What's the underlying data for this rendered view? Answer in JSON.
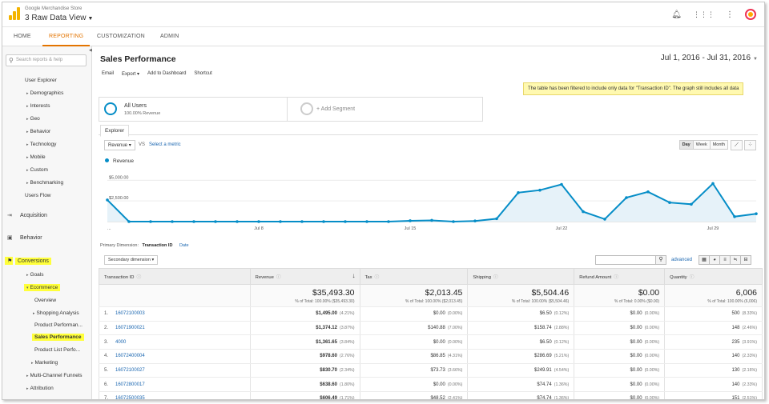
{
  "header": {
    "account_name": "Google Merchandise Store",
    "view_name": "3 Raw Data View",
    "icons": [
      "bell-icon",
      "apps-grid-icon",
      "more-vert-icon",
      "avatar"
    ]
  },
  "nav_tabs": [
    "HOME",
    "REPORTING",
    "CUSTOMIZATION",
    "ADMIN"
  ],
  "sidebar": {
    "search_placeholder": "Search reports & help",
    "items": [
      "User Explorer",
      "Demographics",
      "Interests",
      "Geo",
      "Behavior",
      "Technology",
      "Mobile",
      "Custom",
      "Benchmarking",
      "Users Flow"
    ],
    "sections": [
      "Acquisition",
      "Behavior",
      "Conversions"
    ],
    "conv_items": [
      "Goals",
      "Ecommerce",
      "Overview",
      "Shopping Analysis",
      "Product Performan...",
      "Sales Performance",
      "Product List Perfo...",
      "Marketing",
      "Multi-Channel Funnels",
      "Attribution"
    ]
  },
  "report": {
    "title": "Sales Performance",
    "date_range": "Jul 1, 2016 - Jul 31, 2016",
    "actions": [
      "Email",
      "Export",
      "Add to Dashboard",
      "Shortcut"
    ],
    "filter_note": "The table has been filtered to include only data for \"Transaction ID\". The graph still includes all data",
    "segment": {
      "name": "All Users",
      "sub": "100.00% Revenue",
      "add_label": "+ Add Segment"
    },
    "explorer_tab": "Explorer",
    "metric": "Revenue",
    "vs": "VS",
    "select_metric": "Select a metric",
    "granularity": [
      "Day",
      "Week",
      "Month"
    ],
    "legend": "Revenue",
    "primary_dimension_label": "Primary Dimension:",
    "primary_dimension": "Transaction ID",
    "alt_dimension": "Date",
    "secondary_dimension": "Secondary dimension",
    "advanced": "advanced"
  },
  "chart_data": {
    "type": "area",
    "series": [
      {
        "name": "Revenue",
        "values": [
          2620,
          0,
          0,
          0,
          0,
          0,
          0,
          0,
          0,
          0,
          0,
          0,
          0,
          0,
          100,
          150,
          0,
          80,
          350,
          3500,
          3800,
          4500,
          1200,
          300,
          2900,
          3600,
          2300,
          2100,
          4600,
          600,
          950
        ]
      }
    ],
    "y_ticks": [
      "$5,000.00",
      "$2,500.00"
    ],
    "x_ticks": [
      "Jul 8",
      "Jul 15",
      "Jul 22",
      "Jul 29"
    ],
    "x_start_tick": "...",
    "ylim": [
      0,
      6000
    ],
    "color": "#058dc7"
  },
  "table": {
    "headers": [
      "Transaction ID",
      "Revenue",
      "Tax",
      "Shipping",
      "Refund Amount",
      "Quantity"
    ],
    "totals": [
      {
        "value": "$35,493.30",
        "sub": "% of Total: 100.00% ($35,493.30)"
      },
      {
        "value": "$2,013.45",
        "sub": "% of Total: 100.00% ($2,013.45)"
      },
      {
        "value": "$5,504.46",
        "sub": "% of Total: 100.00% ($5,504.46)"
      },
      {
        "value": "$0.00",
        "sub": "% of Total: 0.00% ($0.00)"
      },
      {
        "value": "6,006",
        "sub": "% of Total: 100.00% (6,006)"
      }
    ],
    "rows": [
      {
        "idx": "1.",
        "id": "16072100003",
        "cells": [
          [
            "$1,495.00",
            "(4.21%)"
          ],
          [
            "$0.00",
            "(0.00%)"
          ],
          [
            "$6.50",
            "(0.12%)"
          ],
          [
            "$0.00",
            "(0.00%)"
          ],
          [
            "500",
            "(8.33%)"
          ]
        ]
      },
      {
        "idx": "2.",
        "id": "16071900021",
        "cells": [
          [
            "$1,374.12",
            "(3.87%)"
          ],
          [
            "$140.88",
            "(7.00%)"
          ],
          [
            "$158.74",
            "(2.88%)"
          ],
          [
            "$0.00",
            "(0.00%)"
          ],
          [
            "148",
            "(2.46%)"
          ]
        ]
      },
      {
        "idx": "3.",
        "id": "4000",
        "cells": [
          [
            "$1,361.65",
            "(3.84%)"
          ],
          [
            "$0.00",
            "(0.00%)"
          ],
          [
            "$6.50",
            "(0.12%)"
          ],
          [
            "$0.00",
            "(0.00%)"
          ],
          [
            "235",
            "(3.91%)"
          ]
        ]
      },
      {
        "idx": "4.",
        "id": "16072400004",
        "cells": [
          [
            "$978.60",
            "(2.76%)"
          ],
          [
            "$86.85",
            "(4.31%)"
          ],
          [
            "$286.69",
            "(5.21%)"
          ],
          [
            "$0.00",
            "(0.00%)"
          ],
          [
            "140",
            "(2.33%)"
          ]
        ]
      },
      {
        "idx": "5.",
        "id": "16072100027",
        "cells": [
          [
            "$830.70",
            "(2.34%)"
          ],
          [
            "$73.73",
            "(3.66%)"
          ],
          [
            "$249.91",
            "(4.54%)"
          ],
          [
            "$0.00",
            "(0.00%)"
          ],
          [
            "130",
            "(2.16%)"
          ]
        ]
      },
      {
        "idx": "6.",
        "id": "16072800017",
        "cells": [
          [
            "$638.60",
            "(1.80%)"
          ],
          [
            "$0.00",
            "(0.00%)"
          ],
          [
            "$74.74",
            "(1.36%)"
          ],
          [
            "$0.00",
            "(0.00%)"
          ],
          [
            "140",
            "(2.33%)"
          ]
        ]
      },
      {
        "idx": "7.",
        "id": "16072500035",
        "cells": [
          [
            "$606.49",
            "(1.71%)"
          ],
          [
            "$48.52",
            "(2.41%)"
          ],
          [
            "$74.74",
            "(1.36%)"
          ],
          [
            "$0.00",
            "(0.00%)"
          ],
          [
            "151",
            "(2.51%)"
          ]
        ]
      }
    ]
  }
}
